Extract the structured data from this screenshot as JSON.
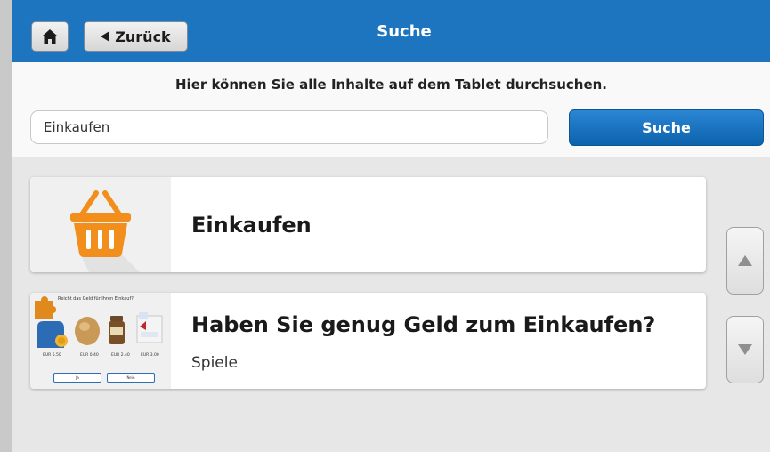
{
  "header": {
    "back_label": "Zurück",
    "title": "Suche"
  },
  "search": {
    "instruction": "Hier können Sie alle Inhalte auf dem Tablet durchsuchen.",
    "value": "Einkaufen",
    "button_label": "Suche"
  },
  "results": [
    {
      "title": "Einkaufen",
      "icon": "shopping-basket-icon"
    },
    {
      "title": "Haben Sie genug Geld zum Einkaufen?",
      "subtitle": "Spiele",
      "preview": {
        "title": "Reicht das Geld für Ihren Einkauf?",
        "prices": [
          "EUR 5.50",
          "EUR 0.40",
          "EUR 2.40",
          "EUR 3.00"
        ],
        "buttons": [
          "Ja",
          "Nein"
        ]
      }
    }
  ],
  "colors": {
    "header_blue": "#1d75bf",
    "basket_orange": "#f28f1c",
    "background": "#e7e7e7"
  }
}
